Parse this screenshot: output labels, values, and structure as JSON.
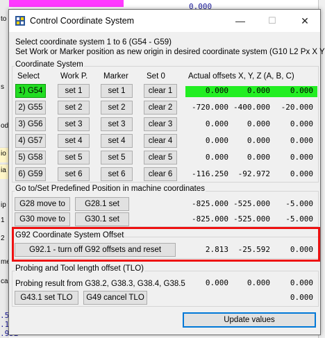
{
  "background": {
    "top_value": "0.000",
    "left_labels": [
      "to",
      "s",
      "od",
      "io",
      "ia",
      "ip",
      "1",
      "2",
      "me",
      "ca"
    ],
    "bottom_values": [
      ".5",
      ".1",
      ".952"
    ]
  },
  "window": {
    "title": "Control Coordinate System",
    "minimize": "—",
    "maximize": "☐",
    "close": "✕"
  },
  "instructions": {
    "line1": "Select coordinate system 1 to 6 (G54 - G59)",
    "line2": "Set Work or Marker position as new origin in desired coordinate system (G10 L2 Px X Y Z)"
  },
  "coord_system": {
    "group_title": "Coordinate System",
    "headers": {
      "select": "Select",
      "work": "Work P.",
      "marker": "Marker",
      "set0": "Set 0",
      "offsets": "Actual offsets X, Y, Z (A, B, C)"
    },
    "rows": [
      {
        "select": "1) G54",
        "work": "set 1",
        "marker": "set 1",
        "clear": "clear 1",
        "x": "0.000",
        "y": "0.000",
        "z": "0.000",
        "active": true
      },
      {
        "select": "2) G55",
        "work": "set 2",
        "marker": "set 2",
        "clear": "clear 2",
        "x": "-720.000",
        "y": "-400.000",
        "z": "-20.000",
        "active": false
      },
      {
        "select": "3) G56",
        "work": "set 3",
        "marker": "set 3",
        "clear": "clear 3",
        "x": "0.000",
        "y": "0.000",
        "z": "0.000",
        "active": false
      },
      {
        "select": "4) G57",
        "work": "set 4",
        "marker": "set 4",
        "clear": "clear 4",
        "x": "0.000",
        "y": "0.000",
        "z": "0.000",
        "active": false
      },
      {
        "select": "5) G58",
        "work": "set 5",
        "marker": "set 5",
        "clear": "clear 5",
        "x": "0.000",
        "y": "0.000",
        "z": "0.000",
        "active": false
      },
      {
        "select": "6) G59",
        "work": "set 6",
        "marker": "set 6",
        "clear": "clear 6",
        "x": "-116.250",
        "y": "-92.972",
        "z": "0.000",
        "active": false
      }
    ]
  },
  "predefined": {
    "group_title": "Go to/Set Predefined Position in machine coordinates",
    "g28_move": "G28 move to",
    "g28_set": "G28.1 set",
    "g28_values": {
      "x": "-825.000",
      "y": "-525.000",
      "z": "-5.000"
    },
    "g30_move": "G30 move to",
    "g30_set": "G30.1 set",
    "g30_values": {
      "x": "-825.000",
      "y": "-525.000",
      "z": "-5.000"
    }
  },
  "g92": {
    "group_title": "G92 Coordinate System Offset",
    "button": "G92.1 - turn off G92 offsets and reset",
    "values": {
      "x": "2.813",
      "y": "-25.592",
      "z": "0.000"
    }
  },
  "probing": {
    "group_title": "Probing and Tool length offset (TLO)",
    "result_label": "Probing result from G38.2, G38.3, G38.4, G38.5",
    "result_values": {
      "x": "0.000",
      "y": "0.000",
      "z": "0.000"
    },
    "set_tlo": "G43.1 set TLO",
    "cancel_tlo": "G49 cancel TLO",
    "tlo_value": "0.000"
  },
  "footer": {
    "update_button": "Update values"
  },
  "colors": {
    "active_green": "#22dd22",
    "highlight_red": "#ee1111",
    "primary_blue": "#0078d7"
  }
}
